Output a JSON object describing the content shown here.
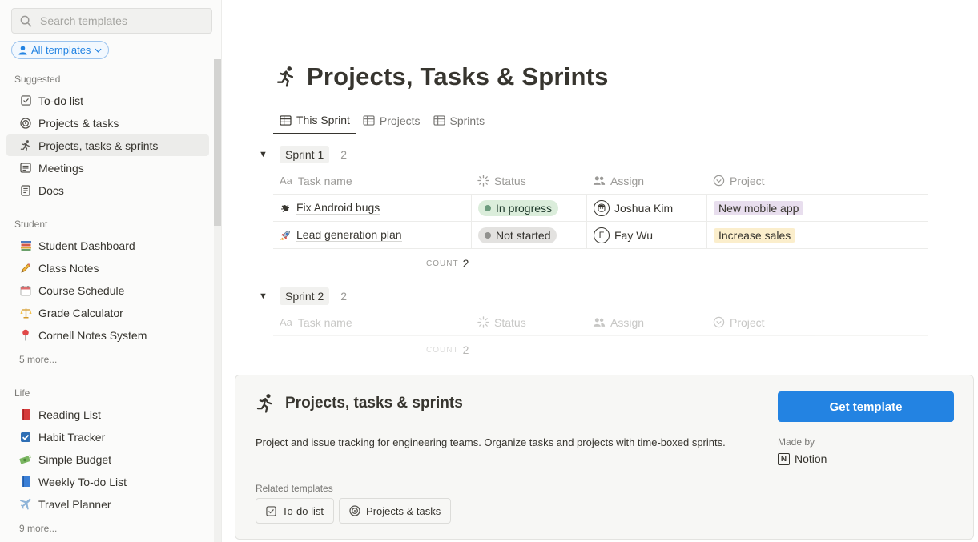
{
  "search": {
    "placeholder": "Search templates"
  },
  "filter": {
    "label": "All templates"
  },
  "sidebar": {
    "sections": [
      {
        "label": "Suggested",
        "items": [
          {
            "label": "To-do list",
            "icon": "checkbox-icon"
          },
          {
            "label": "Projects & tasks",
            "icon": "target-icon"
          },
          {
            "label": "Projects, tasks & sprints",
            "icon": "runner-icon",
            "active": true
          },
          {
            "label": "Meetings",
            "icon": "meeting-notes-icon"
          },
          {
            "label": "Docs",
            "icon": "document-icon"
          }
        ]
      },
      {
        "label": "Student",
        "items": [
          {
            "label": "Student Dashboard",
            "icon": "books-icon"
          },
          {
            "label": "Class Notes",
            "icon": "pencil-icon"
          },
          {
            "label": "Course Schedule",
            "icon": "calendar-icon"
          },
          {
            "label": "Grade Calculator",
            "icon": "scales-icon"
          },
          {
            "label": "Cornell Notes System",
            "icon": "pin-icon"
          }
        ],
        "more": "5 more..."
      },
      {
        "label": "Life",
        "items": [
          {
            "label": "Reading List",
            "icon": "red-book-icon"
          },
          {
            "label": "Habit Tracker",
            "icon": "check-box-icon"
          },
          {
            "label": "Simple Budget",
            "icon": "money-icon"
          },
          {
            "label": "Weekly To-do List",
            "icon": "blue-book-icon"
          },
          {
            "label": "Travel Planner",
            "icon": "airplane-icon"
          }
        ],
        "more": "9 more..."
      }
    ]
  },
  "preview": {
    "title": "Projects, Tasks & Sprints",
    "tabs": [
      "This Sprint",
      "Projects",
      "Sprints"
    ],
    "columns": [
      "Task name",
      "Status",
      "Assign",
      "Project"
    ],
    "count_label": "COUNT",
    "groups": [
      {
        "name": "Sprint 1",
        "count": "2",
        "rows": [
          {
            "task": "Fix Android bugs",
            "task_icon": "bug-icon",
            "status": "In progress",
            "assignee": "Joshua Kim",
            "project": "New mobile app"
          },
          {
            "task": "Lead generation plan",
            "task_icon": "rocket-icon",
            "status": "Not started",
            "assignee": "Fay Wu",
            "assignee_initial": "F",
            "project": "Increase sales"
          }
        ],
        "count_value": "2"
      },
      {
        "name": "Sprint 2",
        "count": "2",
        "rows": [],
        "count_value": "2"
      }
    ]
  },
  "card": {
    "title": "Projects, tasks & sprints",
    "description": "Project and issue tracking for engineering teams. Organize tasks and projects with time-boxed sprints.",
    "related_label": "Related templates",
    "related": [
      "To-do list",
      "Projects & tasks"
    ],
    "cta": "Get template",
    "made_by_label": "Made by",
    "maker": "Notion",
    "maker_logo_letter": "N"
  },
  "colors": {
    "accent": "#2383e2",
    "in_progress_bg": "#dbeddb",
    "in_progress_dot": "#6c9b7d",
    "not_started_bg": "#e3e2e0",
    "not_started_dot": "#91918e",
    "tag_purple": "#e8deee",
    "tag_yellow": "#fbeecc"
  }
}
